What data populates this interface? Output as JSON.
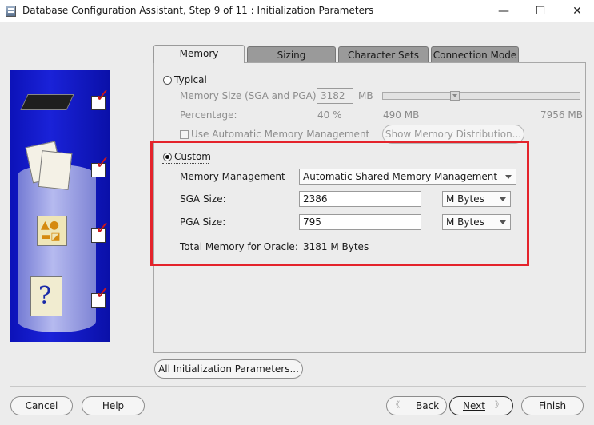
{
  "window": {
    "title": "Database Configuration Assistant, Step 9 of 11 : Initialization Parameters",
    "minimize": "—",
    "maximize": "☐",
    "close": "✕"
  },
  "tabs": [
    {
      "label": "Memory",
      "active": true
    },
    {
      "label": "Sizing",
      "active": false
    },
    {
      "label": "Character Sets",
      "active": false
    },
    {
      "label": "Connection Mode",
      "active": false
    }
  ],
  "typical": {
    "label": "Typical",
    "memory_size_label": "Memory Size (SGA and PGA):",
    "memory_size_value": "3182",
    "memory_size_unit": "MB",
    "percentage_label": "Percentage:",
    "percentage_value": "40 %",
    "slider_min": "490 MB",
    "slider_max": "7956 MB",
    "slider_fraction": 0.36,
    "amm_label": "Use Automatic Memory Management",
    "show_distribution": "Show Memory Distribution..."
  },
  "custom": {
    "label": "Custom",
    "memory_management_label": "Memory Management",
    "memory_management_value": "Automatic Shared Memory Management",
    "sga_label": "SGA Size:",
    "sga_value": "2386",
    "sga_unit": "M Bytes",
    "pga_label": "PGA Size:",
    "pga_value": "795",
    "pga_unit": "M Bytes",
    "total_label": "Total Memory for Oracle:",
    "total_value": "3181 M Bytes"
  },
  "all_params_button": "All Initialization Parameters...",
  "footer": {
    "cancel": "Cancel",
    "help": "Help",
    "back": "Back",
    "back_arrow": "《",
    "next": "Next",
    "next_arrow": "》",
    "finish": "Finish"
  },
  "colors": {
    "highlight": "#e4232b",
    "wizard_blue": "#1a22d8",
    "check_red": "#c8161c"
  }
}
